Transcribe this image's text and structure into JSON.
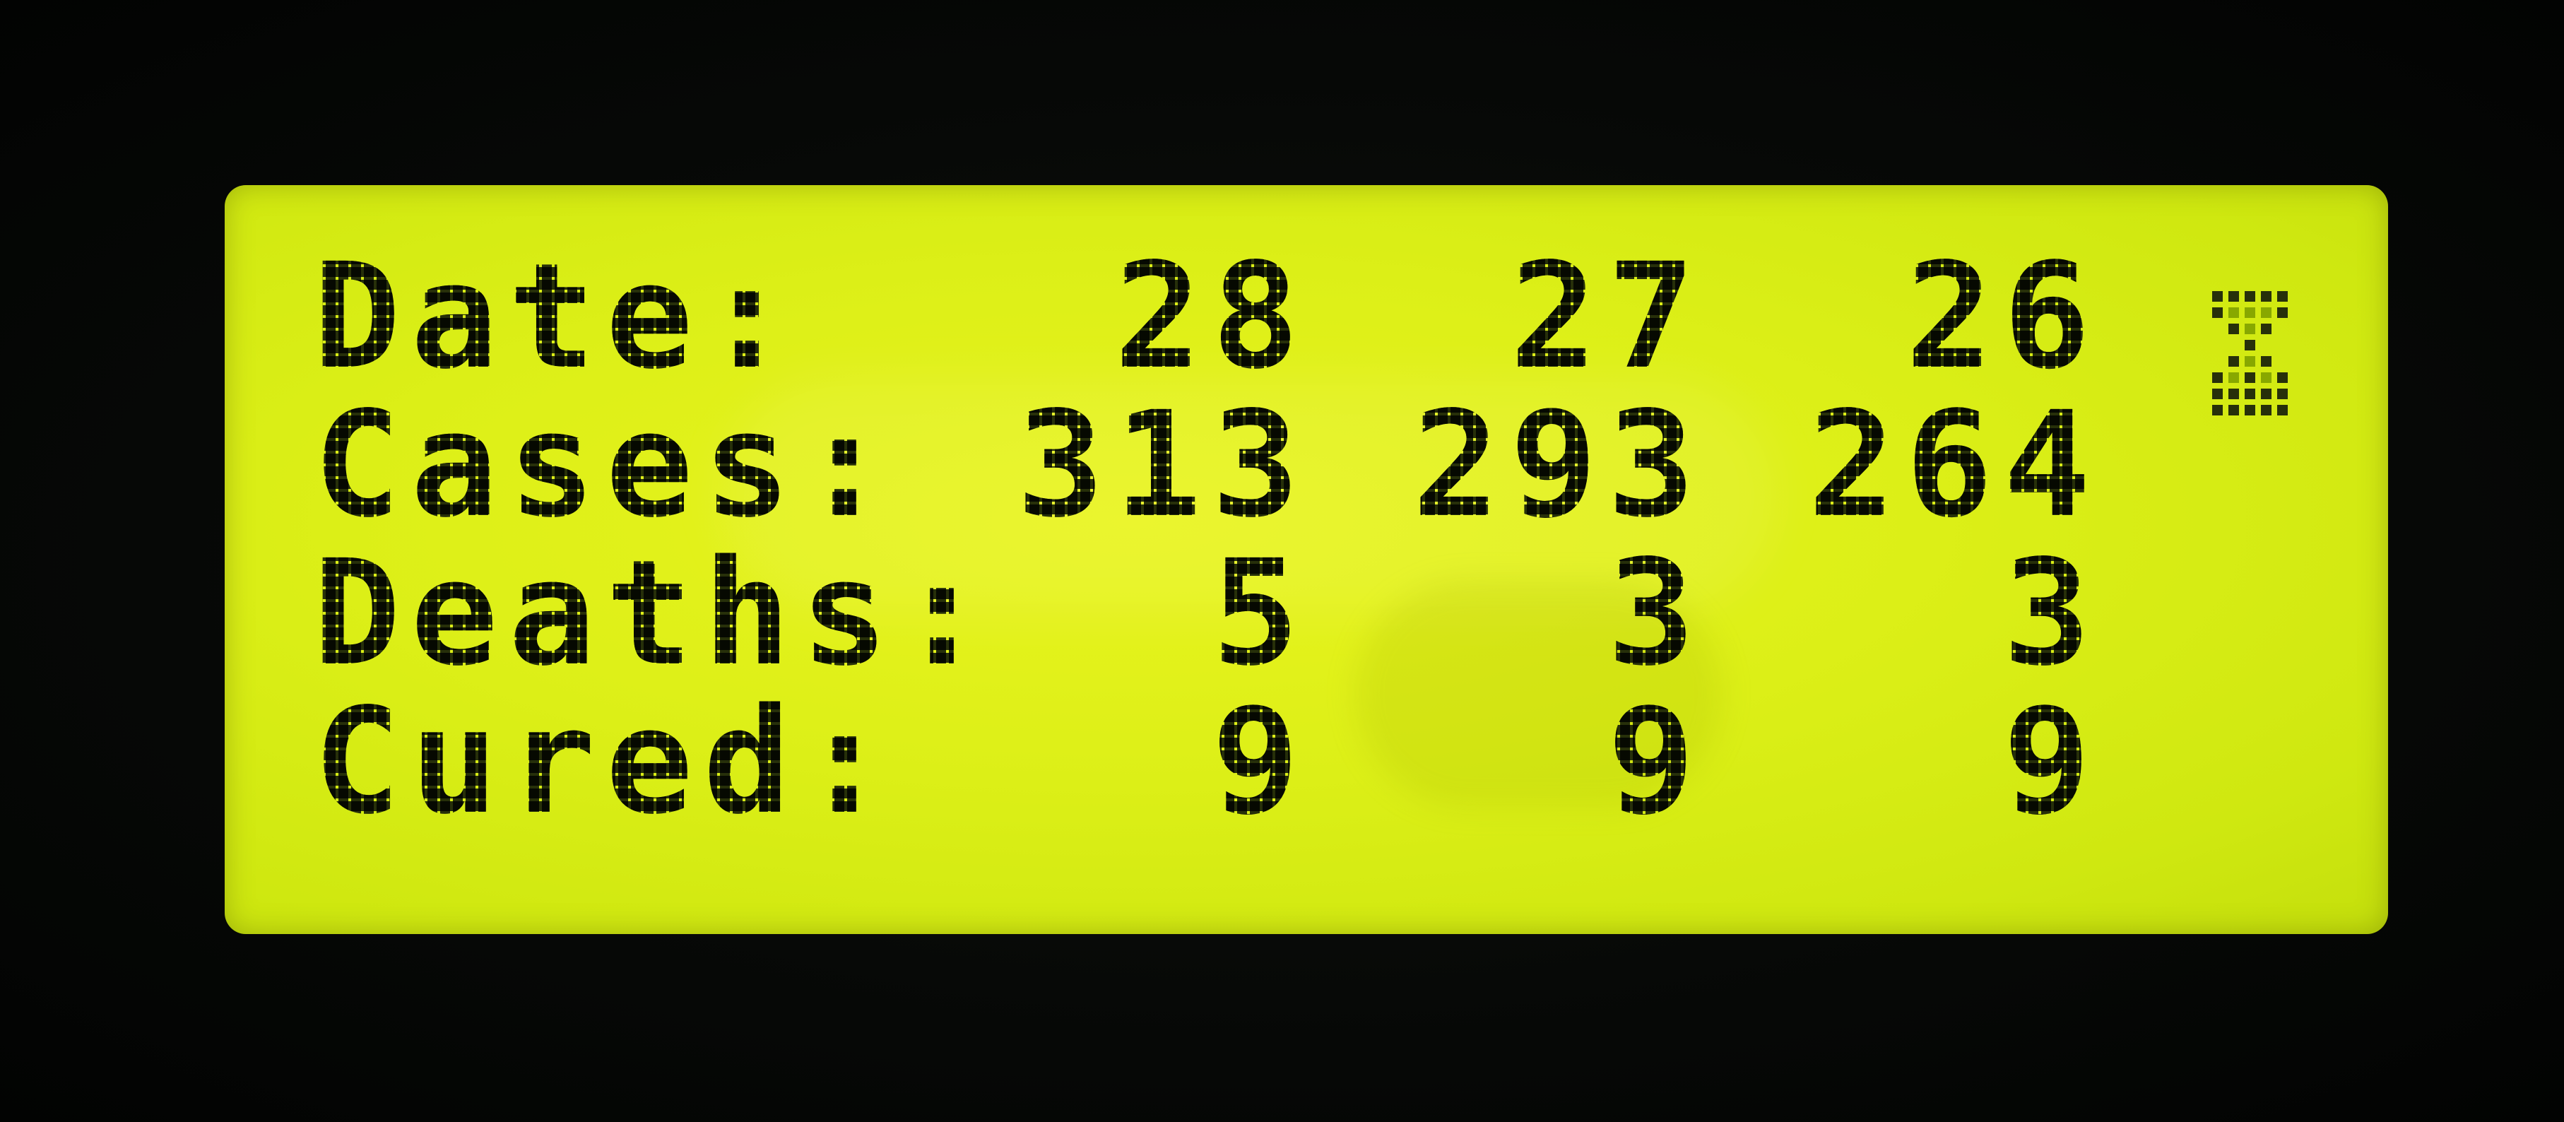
{
  "display": {
    "rows": [
      {
        "label": "Date:",
        "values": [
          "28",
          "27",
          "26"
        ]
      },
      {
        "label": "Cases:",
        "values": [
          "313",
          "293",
          "264"
        ]
      },
      {
        "label": "Deaths:",
        "values": [
          "5",
          "3",
          "3"
        ]
      },
      {
        "label": "Cured:",
        "values": [
          "9",
          "9",
          "9"
        ]
      }
    ],
    "colors": {
      "backlight": "#dcef17",
      "pixel": "#27300a",
      "bezel": "#050705"
    },
    "indicator_icon": "hourglass-icon"
  }
}
